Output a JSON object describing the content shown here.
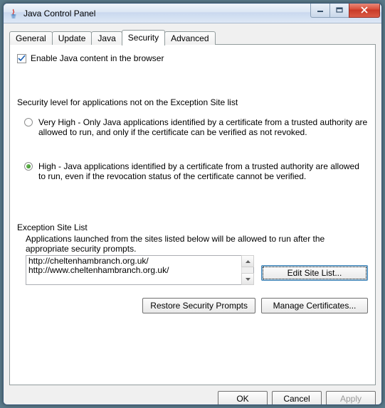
{
  "window": {
    "title": "Java Control Panel"
  },
  "tabs": {
    "general": "General",
    "update": "Update",
    "java": "Java",
    "security": "Security",
    "advanced": "Advanced"
  },
  "security": {
    "enable_label": "Enable Java content in the browser",
    "level_label": "Security level for applications not on the Exception Site list",
    "very_high": "Very High - Only Java applications identified by a certificate from a trusted authority are allowed to run, and only if the certificate can be verified as not revoked.",
    "high": "High - Java applications identified by a certificate from a trusted authority are allowed to run, even if the revocation status of the certificate cannot be verified.",
    "exception_title": "Exception Site List",
    "exception_desc": "Applications launched from the sites listed below will be allowed to run after the appropriate security prompts.",
    "sites": [
      "http://cheltenhambranch.org.uk/",
      "http://www.cheltenhambranch.org.uk/"
    ],
    "edit_site_list": "Edit Site List...",
    "restore_prompts": "Restore Security Prompts",
    "manage_certs": "Manage Certificates..."
  },
  "buttons": {
    "ok": "OK",
    "cancel": "Cancel",
    "apply": "Apply"
  }
}
